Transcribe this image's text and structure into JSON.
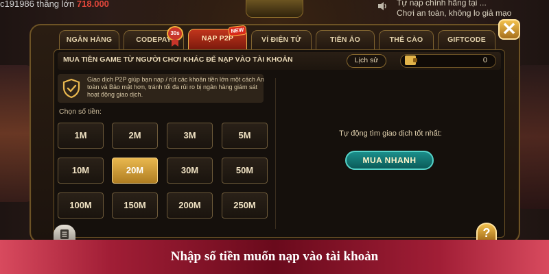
{
  "background": {
    "top_left_text": "c191986 thắng lớn",
    "top_left_amount": "718.000",
    "top_right_line1": "Tự nạp chính hãng tại ...",
    "top_right_line2": "Chơi an toàn, không lo giả mạo"
  },
  "tabs": [
    {
      "label": "NGÂN HÀNG",
      "active": false
    },
    {
      "label": "CODEPAY",
      "active": false
    },
    {
      "label": "NẠP P2P",
      "active": true
    },
    {
      "label": "VÍ ĐIỆN TỬ",
      "active": false
    },
    {
      "label": "TIỀN ẢO",
      "active": false
    },
    {
      "label": "THẺ CÀO",
      "active": false
    },
    {
      "label": "GIFTCODE",
      "active": false
    }
  ],
  "badges": {
    "codepay": "30s",
    "p2p": "NEW"
  },
  "close_label": "✕",
  "header": {
    "title": "MUA TIỀN GAME TỪ NGƯỜI CHƠI KHÁC ĐỂ NẠP VÀO TÀI KHOẢN",
    "history_label": "Lịch sử",
    "wallet_value": "0"
  },
  "info": {
    "text": "Giao dịch P2P giúp bạn nạp / rút các khoản tiền lớn một cách An toàn và Bảo mật hơn, tránh tối đa rủi ro bị ngân hàng giám sát hoạt động giao dịch."
  },
  "amounts": {
    "label": "Chọn số tiền:",
    "options": [
      "1M",
      "2M",
      "3M",
      "5M",
      "10M",
      "20M",
      "30M",
      "50M",
      "100M",
      "150M",
      "200M",
      "250M"
    ],
    "selected": "20M"
  },
  "right_panel": {
    "auto_text": "Tự động tìm giao dịch tốt nhất:",
    "buy_now_label": "MUA NHANH"
  },
  "help_label": "?",
  "caption": "Nhập số tiền muốn nạp vào tài khoản",
  "colors": {
    "gold": "#e9b84f",
    "active_tab": "#c2351c",
    "teal_button": "#1b8e8a",
    "caption_bg": "#a11e36"
  }
}
